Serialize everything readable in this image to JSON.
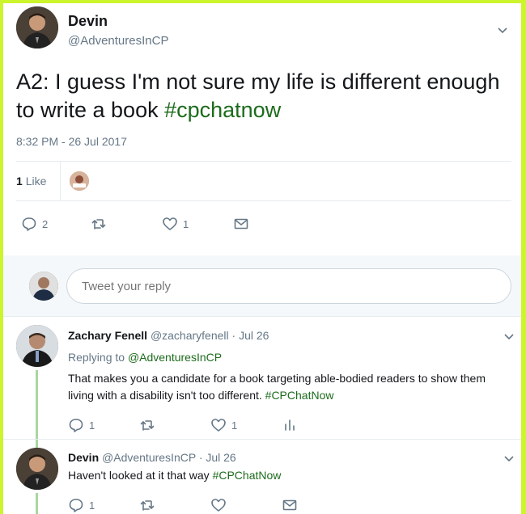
{
  "main_tweet": {
    "author_name": "Devin",
    "author_handle": "@AdventuresInCP",
    "text_before": "A2: I guess I'm not sure my life is different enough to write a book ",
    "hashtag": "#cpchatnow",
    "timestamp": "8:32 PM - 26 Jul 2017",
    "likes_count": "1",
    "likes_label": "Like",
    "actions": {
      "replies": "2",
      "retweets": "",
      "likes": "1"
    }
  },
  "reply_box": {
    "placeholder": "Tweet your reply"
  },
  "replies": [
    {
      "author_name": "Zachary Fenell",
      "author_handle": "@zacharyfenell",
      "date": "· Jul 26",
      "replying_prefix": "Replying to ",
      "replying_to": "@AdventuresInCP",
      "text_before": "That makes you a candidate for a book targeting able-bodied readers to show them living with a disability isn't too different. ",
      "hashtag": "#CPChatNow",
      "actions": {
        "replies": "1",
        "retweets": "",
        "likes": "1"
      }
    },
    {
      "author_name": "Devin",
      "author_handle": "@AdventuresInCP",
      "date": "· Jul 26",
      "text_before": "Haven't looked at it that way ",
      "hashtag": "#CPChatNow",
      "actions": {
        "replies": "1",
        "retweets": "",
        "likes": ""
      }
    }
  ],
  "colors": {
    "accent_green": "#1d6b1d",
    "frame": "#ccf52d",
    "muted": "#657786",
    "thread": "#a9d6a0"
  },
  "icons": [
    "chevron-down-icon",
    "reply-icon",
    "retweet-icon",
    "like-icon",
    "dm-icon",
    "analytics-icon"
  ]
}
